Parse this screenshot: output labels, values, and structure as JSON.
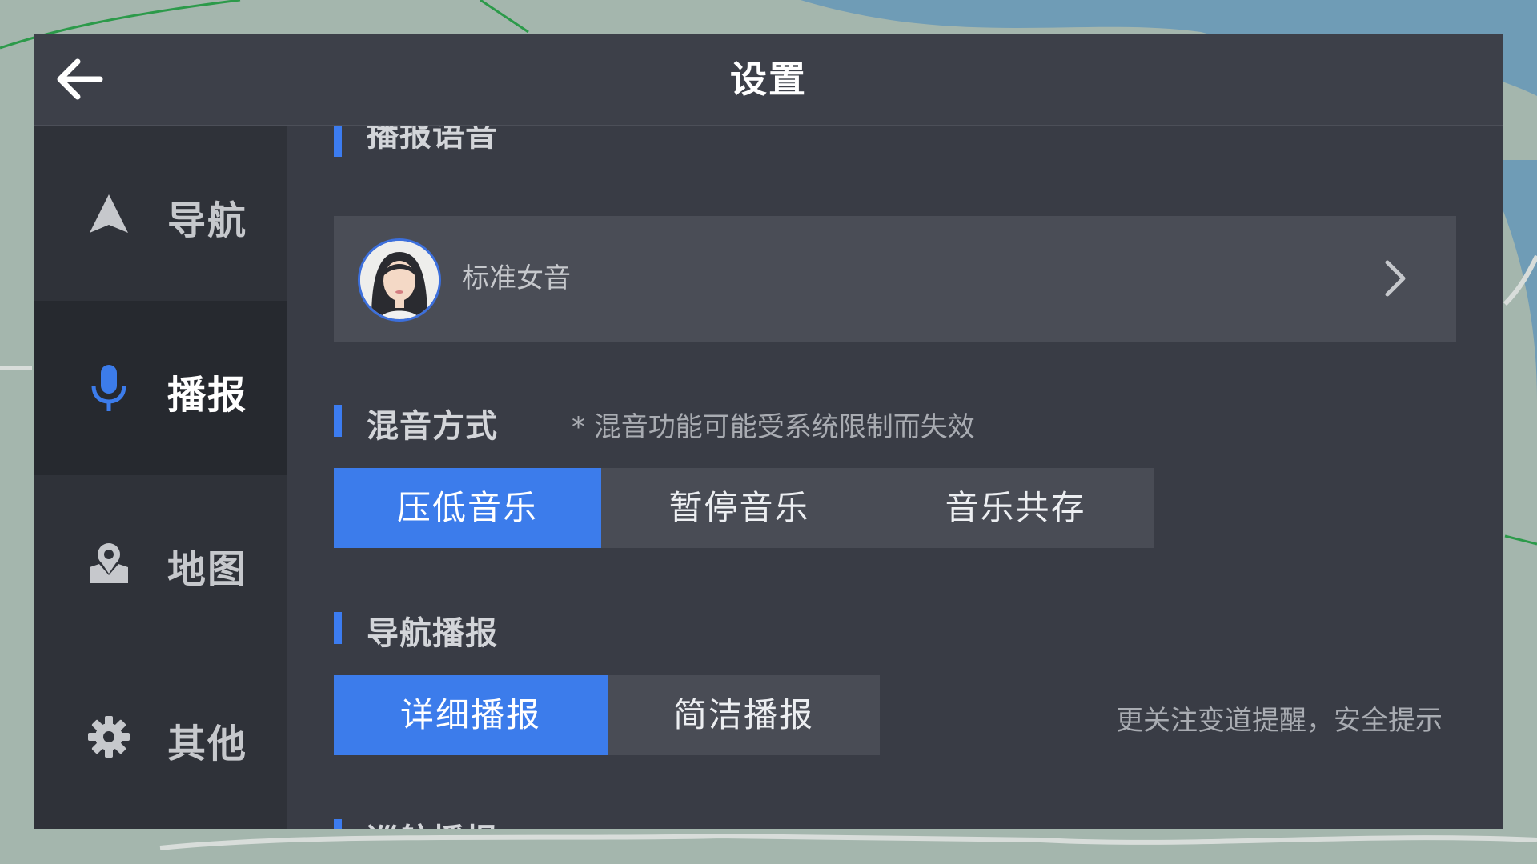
{
  "header": {
    "title": "设置",
    "back_icon": "back-arrow-icon"
  },
  "sidebar": {
    "items": [
      {
        "label": "导航",
        "icon": "navigation-arrow-icon",
        "active": false
      },
      {
        "label": "播报",
        "icon": "microphone-icon",
        "active": true
      },
      {
        "label": "地图",
        "icon": "map-pin-icon",
        "active": false
      },
      {
        "label": "其他",
        "icon": "gear-icon",
        "active": false
      }
    ]
  },
  "sections": {
    "voice": {
      "title": "播报语音",
      "selected_voice": "标准女音"
    },
    "mix": {
      "title": "混音方式",
      "note": "* 混音功能可能受系统限制而失效",
      "options": [
        "压低音乐",
        "暂停音乐",
        "音乐共存"
      ],
      "selected": "压低音乐"
    },
    "nav_broadcast": {
      "title": "导航播报",
      "options": [
        "详细播报",
        "简洁播报"
      ],
      "selected": "详细播报",
      "hint": "更关注变道提醒，安全提示"
    },
    "cruise": {
      "title": "巡航播报"
    }
  },
  "colors": {
    "accent": "#3c7ceb",
    "panel": "#393c45",
    "sidebar": "#2f3239",
    "sidebar_active": "#26292f"
  }
}
